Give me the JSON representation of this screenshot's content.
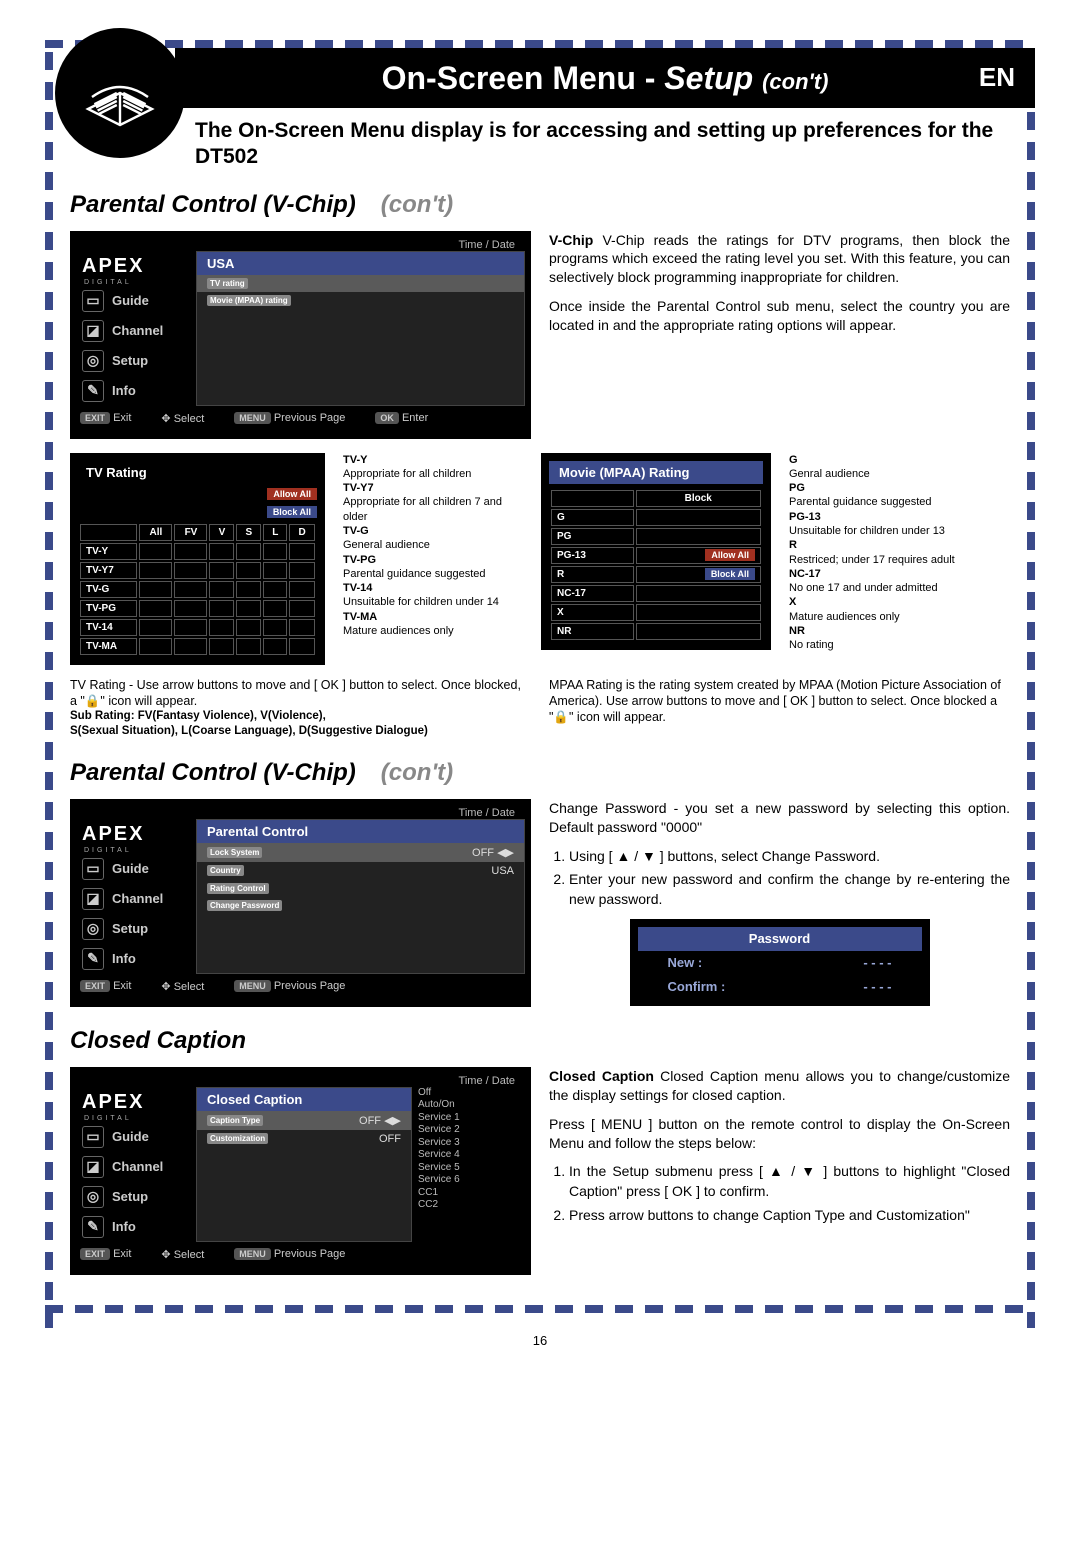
{
  "header": {
    "title_main": "On-Screen Menu - ",
    "title_em": "Setup ",
    "title_small": "(con't)",
    "lang": "EN"
  },
  "intro": "The On-Screen Menu display is for accessing and setting up preferences for the DT502",
  "section1": {
    "title": "Parental Control (V-Chip)",
    "suffix": "(con't)"
  },
  "section2": {
    "title": "Parental Control (V-Chip)",
    "suffix": "(con't)"
  },
  "section3": {
    "title": "Closed Caption"
  },
  "osd_common": {
    "time_date": "Time / Date",
    "logo": "APEX",
    "logo_sub": "DIGITAL",
    "nav": [
      "Guide",
      "Channel",
      "Setup",
      "Info"
    ],
    "foot_exit": "EXIT",
    "foot_exit_lbl": "Exit",
    "foot_select": "Select",
    "foot_menu": "MENU",
    "foot_menu_lbl": "Previous Page",
    "foot_ok": "OK",
    "foot_ok_lbl": "Enter"
  },
  "osd1": {
    "panel_title": "USA",
    "rows": [
      {
        "label": "TV rating",
        "hi": true
      },
      {
        "label": "Movie (MPAA) rating",
        "hi": false
      }
    ]
  },
  "vchip_text": {
    "p1": "V-Chip reads the ratings for DTV programs, then block the programs which exceed the rating level you set. With this feature, you can selectively block programming inappropriate for children.",
    "p2": "Once inside the Parental Control sub menu, select the country you are located in and the appropriate rating options will appear."
  },
  "tv_rating": {
    "title": "TV Rating",
    "allow": "Allow All",
    "block": "Block All",
    "cols": [
      "All",
      "FV",
      "V",
      "S",
      "L",
      "D"
    ],
    "rows": [
      "TV-Y",
      "TV-Y7",
      "TV-G",
      "TV-PG",
      "TV-14",
      "TV-MA"
    ],
    "defs": [
      {
        "k": "TV-Y",
        "v": "Appropriate for all children"
      },
      {
        "k": "TV-Y7",
        "v": "Appropriate for all children 7 and older"
      },
      {
        "k": "TV-G",
        "v": "General audience"
      },
      {
        "k": "TV-PG",
        "v": "Parental guidance suggested"
      },
      {
        "k": "TV-14",
        "v": "Unsuitable for children under 14"
      },
      {
        "k": "TV-MA",
        "v": "Mature audiences only"
      }
    ],
    "foot1": "TV Rating - Use arrow buttons to move and [ OK ] button to select. Once blocked, a \"🔒\" icon will appear.",
    "foot2": "Sub Rating: FV(Fantasy Violence), V(Violence),",
    "foot3": "S(Sexual Situation), L(Coarse Language), D(Suggestive Dialogue)"
  },
  "mpaa_rating": {
    "title": "Movie (MPAA) Rating",
    "block": "Block",
    "allow": "Allow All",
    "blockall": "Block All",
    "rows": [
      "G",
      "PG",
      "PG-13",
      "R",
      "NC-17",
      "X",
      "NR"
    ],
    "defs": [
      {
        "k": "G",
        "v": "Genral audience"
      },
      {
        "k": "PG",
        "v": "Parental guidance suggested"
      },
      {
        "k": "PG-13",
        "v": "Unsuitable for children under 13"
      },
      {
        "k": "R",
        "v": "Restriced; under 17 requires adult"
      },
      {
        "k": "NC-17",
        "v": "No one 17 and under admitted"
      },
      {
        "k": "X",
        "v": "Mature audiences only"
      },
      {
        "k": "NR",
        "v": "No rating"
      }
    ],
    "foot": "MPAA Rating is the rating system created by MPAA (Motion Picture Association of America). Use arrow buttons to move and [ OK ] button to select. Once blocked a \"🔒\" icon will appear."
  },
  "osd2": {
    "panel_title": "Parental Control",
    "rows": [
      {
        "label": "Lock System",
        "val": "OFF",
        "cc": true,
        "hi": true
      },
      {
        "label": "Country",
        "val": "USA"
      },
      {
        "label": "Rating Control",
        "val": ""
      },
      {
        "label": "Change Password",
        "val": ""
      }
    ]
  },
  "change_pw": {
    "intro": "Change Password - you set a new password by selecting this option. Default password \"0000\"",
    "steps": [
      "Using [ ▲ / ▼ ] buttons, select Change Password.",
      "Enter your new password and confirm the change by re-entering the new password."
    ],
    "box_title": "Password",
    "new": "New :",
    "confirm": "Confirm :",
    "dashes": "-   -   -   -"
  },
  "osd3": {
    "panel_title": "Closed Caption",
    "rows": [
      {
        "label": "Caption Type",
        "val": "OFF",
        "cc": true,
        "hi": true
      },
      {
        "label": "Customization",
        "val": "OFF"
      }
    ],
    "services": [
      "Off",
      "Auto/On",
      "Service 1",
      "Service 2",
      "Service 3",
      "Service 4",
      "Service 5",
      "Service 6",
      "CC1",
      "CC2"
    ]
  },
  "cc_text": {
    "p1": "Closed Caption menu allows you to change/customize the display settings for closed caption.",
    "p2": "Press [ MENU ] button on the remote control to display the On-Screen Menu and follow the steps below:",
    "steps": [
      "In the Setup submenu press [ ▲ / ▼ ] buttons to  highlight \"Closed Caption\" press [ OK ] to confirm.",
      "Press arrow buttons to change Caption Type and Customization\""
    ]
  },
  "page_number": "16"
}
